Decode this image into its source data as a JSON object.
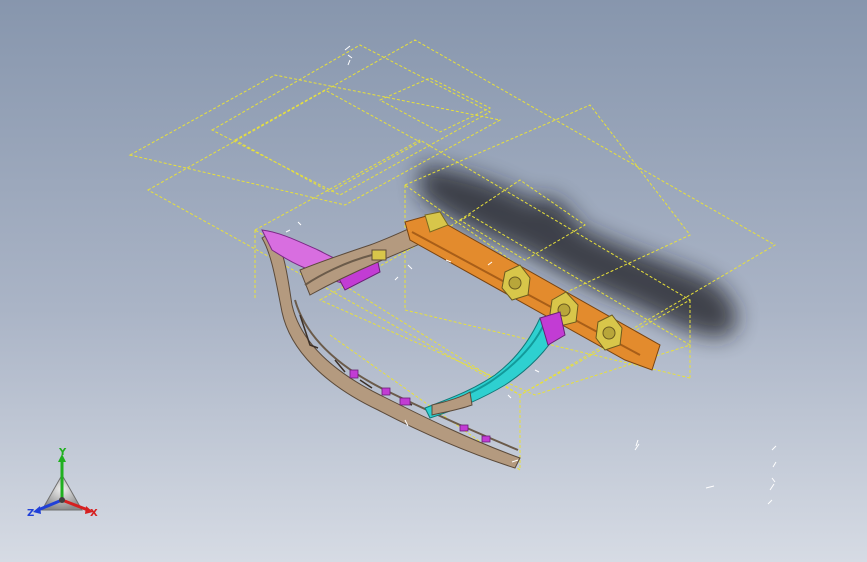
{
  "app": {
    "name": "CAD 3D viewport",
    "view": "isometric"
  },
  "colors": {
    "background_top": "#8d9db3",
    "background_bottom": "#d4d9e3",
    "wireframe": "#e8e13a",
    "frame_tan": "#b49a7f",
    "frame_dark": "#6b5b4a",
    "rail_orange": "#e38b2d",
    "mount_yellow": "#d8c64a",
    "arm_cyan": "#2ed0d0",
    "panel_magenta": "#c23cd4",
    "panel_pink": "#d86ee0",
    "shadow": "#1e1e22",
    "axis_x": "#d62020",
    "axis_y": "#20b020",
    "axis_z": "#2040d8"
  },
  "model": {
    "description_icon": "subframe-assembly-icon",
    "parts": [
      "front-crossmember",
      "left-side-rail",
      "right-side-rail",
      "rear-crossmember",
      "engine-mounts"
    ]
  },
  "compass": {
    "x_label": "X",
    "y_label": "Y",
    "z_label": "Z"
  }
}
